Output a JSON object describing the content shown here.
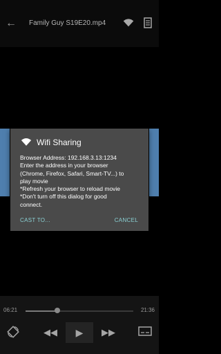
{
  "header": {
    "back_icon": "arrow-left-icon",
    "title": "Family Guy S19E20.mp4",
    "wifi_icon": "wifi-icon",
    "menu_icon": "list-icon"
  },
  "dialog": {
    "icon": "wifi-icon",
    "title": "Wifi Sharing",
    "lines": [
      "Browser Address: 192.168.3.13:1234",
      "Enter the address in your browser",
      "(Chrome, Firefox, Safari, Smart-TV...) to",
      "play movie",
      "*Refresh your browser to reload movie",
      "*Don't turn off this dialog for good",
      "connect."
    ],
    "cast_label": "CAST TO...",
    "cancel_label": "CANCEL",
    "accent": "#8bd1d4"
  },
  "player": {
    "current_time": "06:21",
    "total_time": "21:36",
    "progress": 0.294,
    "controls": {
      "rotate_icon": "rotate-icon",
      "rewind_icon": "rewind-icon",
      "play_icon": "play-icon",
      "forward_icon": "fast-forward-icon",
      "subtitle_icon": "subtitle-icon"
    }
  }
}
